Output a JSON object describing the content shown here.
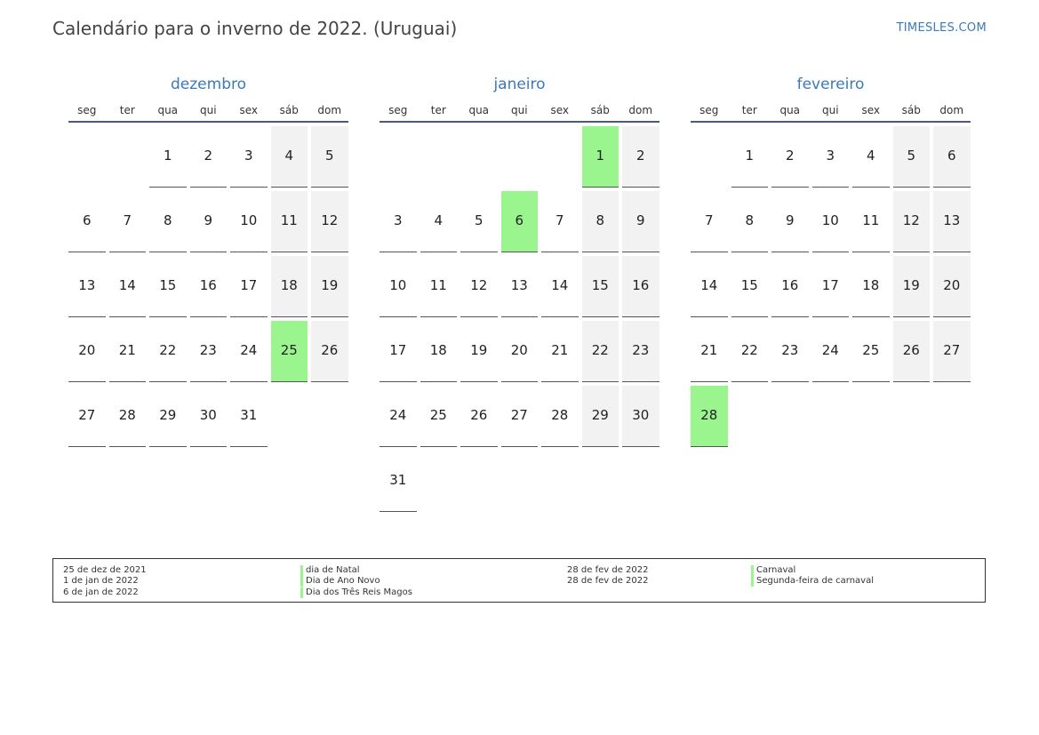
{
  "header": {
    "title": "Calendário para o inverno de 2022. (Uruguai)",
    "site": "TIMESLES.COM"
  },
  "colors": {
    "accent": "#3a7ab8",
    "holiday": "#9af58f",
    "weekend": "#f2f2f2"
  },
  "weekdays": [
    "seg",
    "ter",
    "qua",
    "qui",
    "sex",
    "sáb",
    "dom"
  ],
  "months": [
    {
      "name": "dezembro",
      "offset": 2,
      "days": 31,
      "holidays": [
        25
      ]
    },
    {
      "name": "janeiro",
      "offset": 5,
      "days": 31,
      "holidays": [
        1,
        6
      ]
    },
    {
      "name": "fevereiro",
      "offset": 1,
      "days": 28,
      "holidays": [
        28
      ]
    }
  ],
  "legend": [
    {
      "date": "25 de dez de 2021",
      "name": "dia de Natal"
    },
    {
      "date": "1 de jan de 2022",
      "name": "Dia de Ano Novo"
    },
    {
      "date": "6 de jan de 2022",
      "name": "Dia dos Três Reis Magos"
    },
    {
      "date": "28 de fev de 2022",
      "name": "Carnaval"
    },
    {
      "date": "28 de fev de 2022",
      "name": "Segunda-feira de carnaval"
    }
  ]
}
